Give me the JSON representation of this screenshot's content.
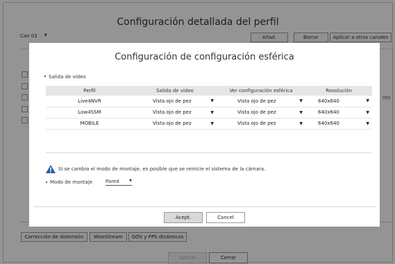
{
  "outer": {
    "title": "Configuración detallada del perfil",
    "channel": "Can 03",
    "add_label": "Añad.",
    "delete_label": "Borrar",
    "apply_all_label": "Aplicar a otros canales",
    "side_text": "oto",
    "tabs": [
      "Corrección de distorsión",
      "WiseStream",
      "GOV y FPS dinámicos"
    ],
    "apply_label": "Aplicar",
    "close_label": "Cerrar"
  },
  "modal": {
    "title": "Configuración de configuración esférica",
    "section_label": "Salida de vídeo",
    "columns": [
      "Perfil",
      "Salida de vídeo",
      "Ver configuración esférica",
      "Resolución"
    ],
    "rows": [
      {
        "perfil": "Live4NVR",
        "salida": "Vista ojo de pez",
        "ver": "Vista ojo de pez",
        "res": "640x640"
      },
      {
        "perfil": "Low4SSM",
        "salida": "Vista ojo de pez",
        "ver": "Vista ojo de pez",
        "res": "640x640"
      },
      {
        "perfil": "MOBILE",
        "salida": "Vista ojo de pez",
        "ver": "Vista ojo de pez",
        "res": "640x640"
      }
    ],
    "warning": "Si se cambia el modo de montaje, es posible que se reinicie el sistema de la cámara.",
    "mount_label": "Modo de montaje",
    "mount_value": "Pared",
    "accept_label": "Acept.",
    "cancel_label": "Cancel"
  },
  "colors": {
    "warning_icon": "#1f5fa8",
    "dim_overlay": "rgba(0,0,0,0.42)"
  },
  "icons": {
    "dropdown": "triangle-down",
    "warning": "warning-triangle-icon"
  }
}
